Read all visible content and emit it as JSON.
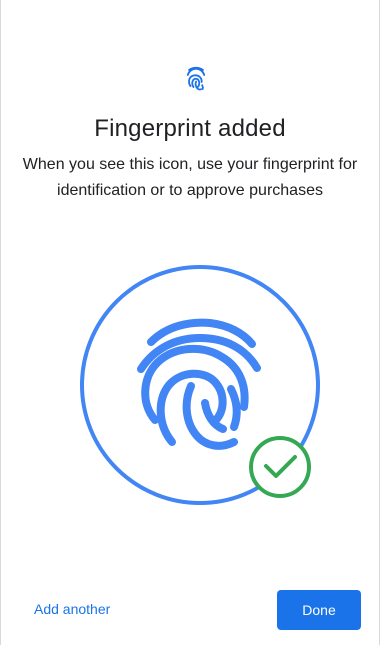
{
  "header": {
    "icon": "fingerprint-icon",
    "title": "Fingerprint added",
    "subtitle": "When you see this icon, use your fingerprint for identification or to approve purchases"
  },
  "illustration": {
    "icon": "fingerprint-icon",
    "badge_icon": "check-circle-icon",
    "colors": {
      "ring": "#4285F4",
      "fingerprint": "#4285F4",
      "check": "#34A853"
    }
  },
  "footer": {
    "secondary_label": "Add another",
    "primary_label": "Done"
  },
  "colors": {
    "accent": "#1A73E8",
    "text": "#202124",
    "background": "#FFFFFF"
  }
}
